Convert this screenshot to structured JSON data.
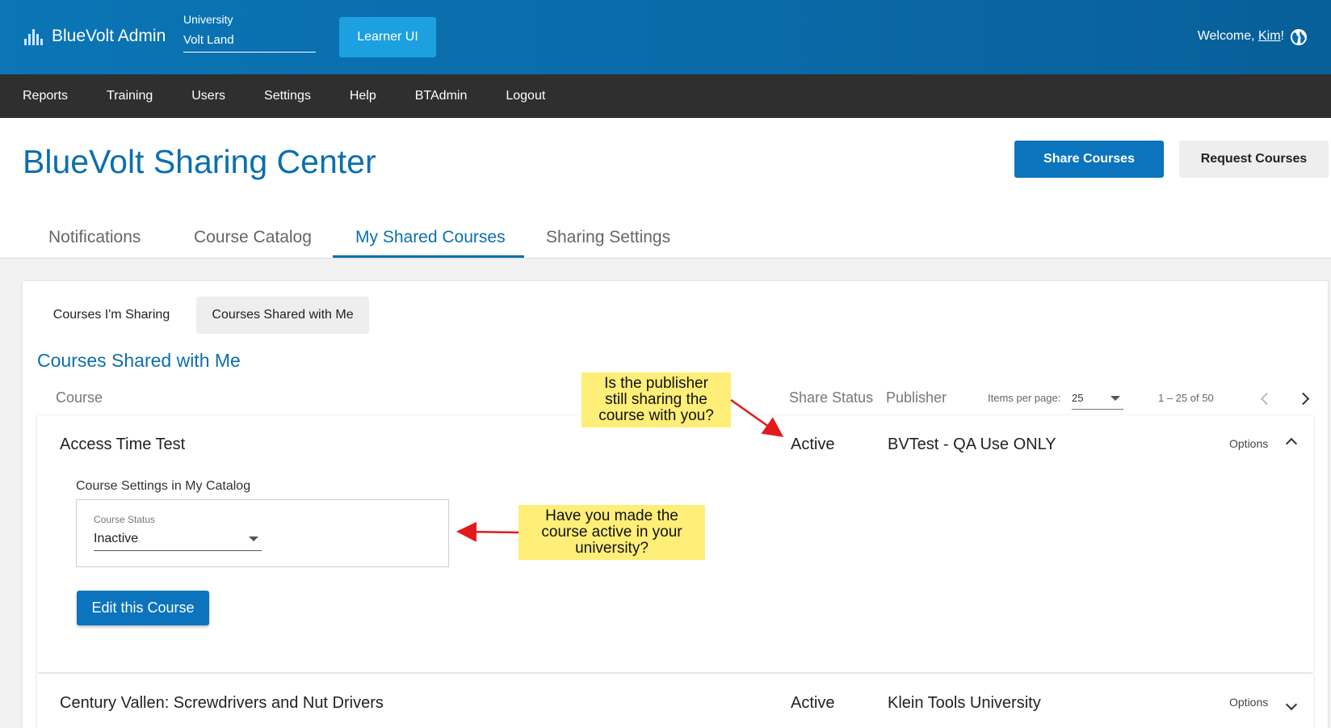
{
  "header": {
    "brand": "BlueVolt Admin",
    "university_label": "University",
    "university_value": "Volt Land",
    "learner_ui": "Learner UI",
    "welcome_prefix": "Welcome, ",
    "user_name": "Kim",
    "welcome_suffix": "!"
  },
  "nav": [
    "Reports",
    "Training",
    "Users",
    "Settings",
    "Help",
    "BTAdmin",
    "Logout"
  ],
  "page": {
    "title": "BlueVolt Sharing Center",
    "share_button": "Share Courses",
    "request_button": "Request Courses"
  },
  "tabs": [
    "Notifications",
    "Course Catalog",
    "My Shared Courses",
    "Sharing Settings"
  ],
  "active_tab": "My Shared Courses",
  "subtabs": [
    "Courses I'm Sharing",
    "Courses Shared with Me"
  ],
  "section_title": "Courses Shared with Me",
  "table": {
    "columns": {
      "course": "Course",
      "share_status": "Share Status",
      "publisher": "Publisher"
    },
    "items_per_page_label": "Items per page:",
    "items_per_page": "25",
    "range": "1 – 25 of 50",
    "rows": [
      {
        "course": "Access Time Test",
        "share_status": "Active",
        "publisher": "BVTest - QA Use ONLY",
        "options": "Options",
        "expanded": true
      },
      {
        "course": "Century Vallen: Screwdrivers and Nut Drivers",
        "share_status": "Active",
        "publisher": "Klein Tools University",
        "options": "Options",
        "expanded": false
      }
    ]
  },
  "expanded": {
    "settings_label": "Course Settings in My Catalog",
    "status_label": "Course Status",
    "status_value": "Inactive",
    "edit_button": "Edit this Course"
  },
  "callouts": {
    "publisher": [
      "Is the publisher",
      "still sharing the",
      "course with you?"
    ],
    "active": [
      "Have you made the",
      "course active in your",
      "university?"
    ]
  },
  "colors": {
    "brand_blue": "#0b6fae",
    "button_blue": "#0b74bd",
    "nav_bg": "#2f2f2f",
    "callout_bg": "#ffee78",
    "arrow_red": "#e11b1b"
  }
}
